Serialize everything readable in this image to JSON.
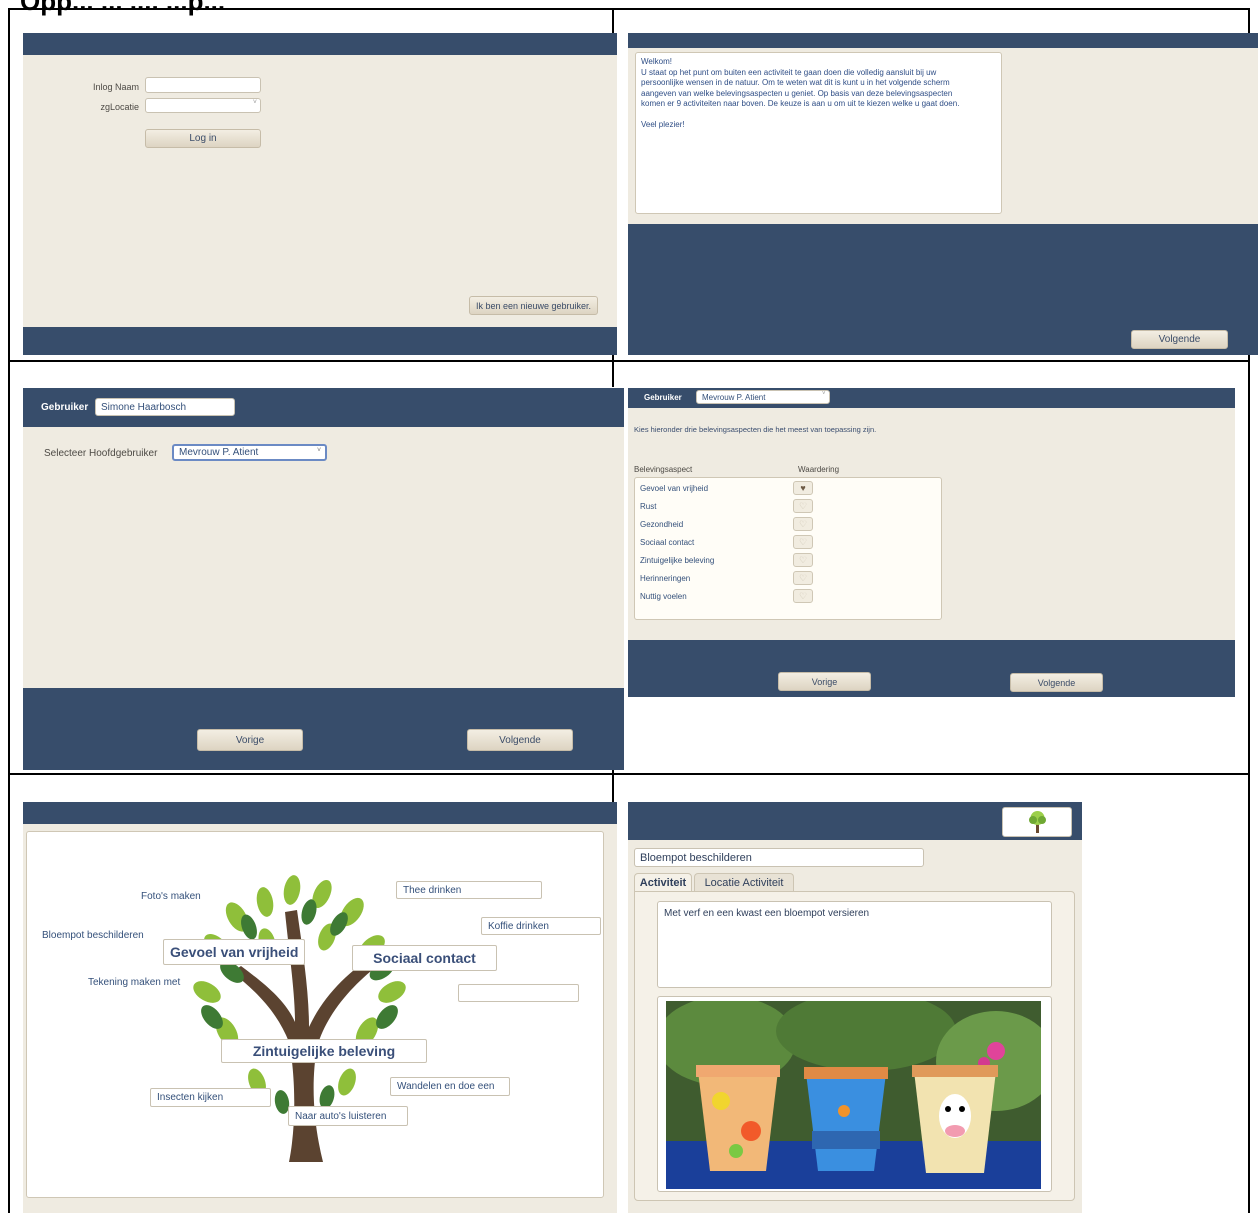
{
  "heading": "Opp... ... .... ...p...",
  "login": {
    "name_label": "Inlog Naam",
    "location_label": "zgLocatie",
    "login_button": "Log in",
    "new_user_button": "Ik ben een nieuwe gebruiker."
  },
  "welcome": {
    "lines": [
      "Welkom!",
      "U staat op het punt om buiten een activiteit te gaan doen die volledig aansluit bij uw",
      "persoonlijke wensen in de natuur. Om te weten wat dit is kunt u in het volgende scherm",
      "aangeven van welke belevingsaspecten u geniet. Op basis van deze belevingsaspecten",
      "komen er 9 activiteiten naar boven. De keuze is aan u om uit te kiezen welke u gaat doen.",
      "",
      "Veel plezier!"
    ],
    "next_button": "Volgende"
  },
  "select_user": {
    "user_label": "Gebruiker",
    "user_value": "Simone Haarbosch",
    "main_user_label": "Selecteer Hoofdgebruiker",
    "main_user_value": "Mevrouw P. Atient",
    "prev_button": "Vorige",
    "next_button": "Volgende"
  },
  "aspects": {
    "user_label": "Gebruiker",
    "user_value": "Mevrouw P. Atient",
    "instruction": "Kies hieronder drie belevingsaspecten die het meest van toepassing zijn.",
    "col_aspect": "Belevingsaspect",
    "col_rating": "Waardering",
    "rows": [
      {
        "label": "Gevoel van vrijheid",
        "selected": true
      },
      {
        "label": "Rust",
        "selected": false
      },
      {
        "label": "Gezondheid",
        "selected": false
      },
      {
        "label": "Sociaal contact",
        "selected": false
      },
      {
        "label": "Zintuigelijke beleving",
        "selected": false
      },
      {
        "label": "Herinneringen",
        "selected": false
      },
      {
        "label": "Nuttig voelen",
        "selected": false
      }
    ],
    "prev_button": "Vorige",
    "next_button": "Volgende"
  },
  "tree": {
    "foto": "Foto's maken",
    "thee": "Thee drinken",
    "koffie": "Koffie drinken",
    "bloempot": "Bloempot beschilderen",
    "vrijheid": "Gevoel van vrijheid",
    "sociaal": "Sociaal contact",
    "tekening": "Tekening maken met",
    "zintuig": "Zintuigelijke beleving",
    "insecten": "Insecten kijken",
    "wandelen": "Wandelen en doe een",
    "autos": "Naar auto's luisteren"
  },
  "activity": {
    "title": "Bloempot beschilderen",
    "tab_activity": "Activiteit",
    "tab_location": "Locatie Activiteit",
    "description": "Met verf en een kwast een bloempot versieren"
  },
  "colors": {
    "navy": "#374d6b",
    "beige": "#efebe1",
    "text_blue": "#34507a",
    "leaf_green": "#8fbf3a",
    "trunk": "#5b4330"
  }
}
